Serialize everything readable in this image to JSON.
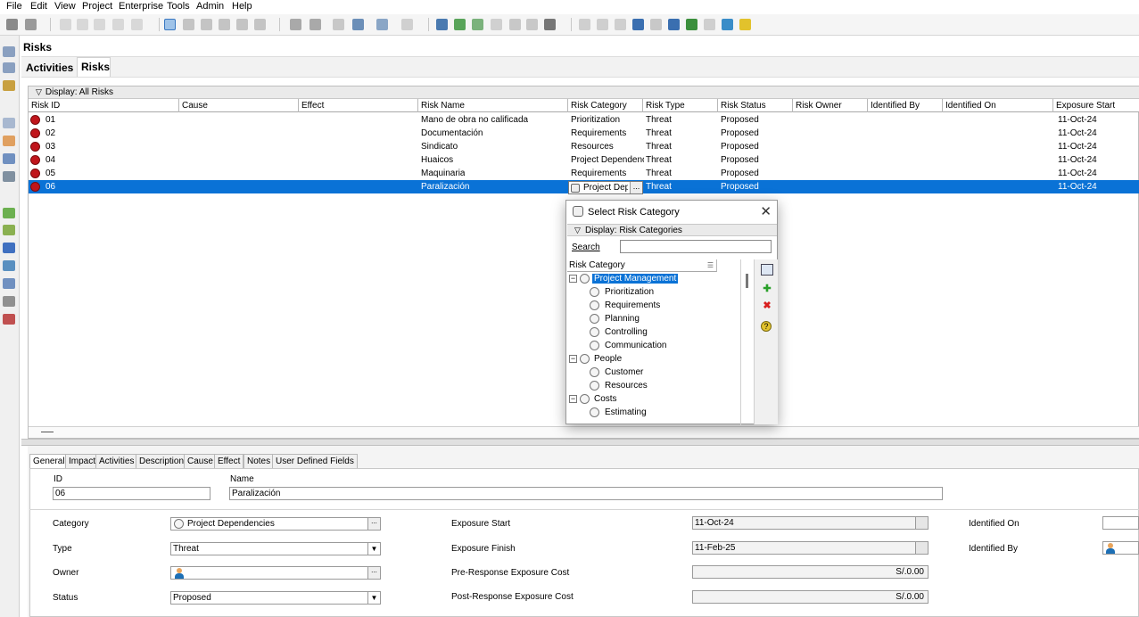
{
  "menu": [
    "File",
    "Edit",
    "View",
    "Project",
    "Enterprise",
    "Tools",
    "Admin",
    "Help"
  ],
  "page_title": "Risks",
  "tabs": {
    "activities": "Activities",
    "risks": "Risks"
  },
  "grid": {
    "display_label": "Display: All Risks",
    "columns": [
      "Risk ID",
      "Cause",
      "Effect",
      "Risk Name",
      "Risk Category",
      "Risk Type",
      "Risk Status",
      "Risk Owner",
      "Identified By",
      "Identified On",
      "Exposure Start"
    ],
    "rows": [
      {
        "id": "01",
        "name": "Mano de obra no calificada",
        "category": "Prioritization",
        "type": "Threat",
        "status": "Proposed",
        "start": "11-Oct-24"
      },
      {
        "id": "02",
        "name": "Documentación",
        "category": "Requirements",
        "type": "Threat",
        "status": "Proposed",
        "start": "11-Oct-24"
      },
      {
        "id": "03",
        "name": "Sindicato",
        "category": "Resources",
        "type": "Threat",
        "status": "Proposed",
        "start": "11-Oct-24"
      },
      {
        "id": "04",
        "name": "Huaicos",
        "category": "Project Dependenci",
        "type": "Threat",
        "status": "Proposed",
        "start": "11-Oct-24"
      },
      {
        "id": "05",
        "name": "Maquinaria",
        "category": "Requirements",
        "type": "Threat",
        "status": "Proposed",
        "start": "11-Oct-24"
      },
      {
        "id": "06",
        "name": "Paralización",
        "category": "Project Depe",
        "type": "Threat",
        "status": "Proposed",
        "start": "11-Oct-24",
        "selected": true
      }
    ],
    "editor_dots": "..."
  },
  "popup": {
    "title": "Select Risk Category",
    "display_label": "Display: Risk Categories",
    "search_label": "Search",
    "search_value": "",
    "column_header": "Risk Category",
    "tree": [
      {
        "label": "Project Management",
        "level": 0,
        "expanded": true,
        "selected": true
      },
      {
        "label": "Prioritization",
        "level": 1
      },
      {
        "label": "Requirements",
        "level": 1
      },
      {
        "label": "Planning",
        "level": 1
      },
      {
        "label": "Controlling",
        "level": 1
      },
      {
        "label": "Communication",
        "level": 1
      },
      {
        "label": "People",
        "level": 0,
        "expanded": true
      },
      {
        "label": "Customer",
        "level": 1
      },
      {
        "label": "Resources",
        "level": 1
      },
      {
        "label": "Costs",
        "level": 0,
        "expanded": true
      },
      {
        "label": "Estimating",
        "level": 1
      }
    ],
    "close_glyph": "✕",
    "expand_glyph": "−"
  },
  "detail_tabs": [
    "General",
    "Impact",
    "Activities",
    "Description",
    "Cause",
    "Effect",
    "Notes",
    "User Defined Fields"
  ],
  "details": {
    "id_label": "ID",
    "id_value": "06",
    "name_label": "Name",
    "name_value": "Paralización",
    "category_label": "Category",
    "category_value": "Project Dependencies",
    "type_label": "Type",
    "type_value": "Threat",
    "owner_label": "Owner",
    "owner_value": "",
    "status_label": "Status",
    "status_value": "Proposed",
    "exposure_start_label": "Exposure Start",
    "exposure_start_value": "11-Oct-24",
    "exposure_finish_label": "Exposure Finish",
    "exposure_finish_value": "11-Feb-25",
    "pre_cost_label": "Pre-Response Exposure Cost",
    "pre_cost_value": "S/.0.00",
    "post_cost_label": "Post-Response Exposure Cost",
    "post_cost_value": "S/.0.00",
    "identified_on_label": "Identified On",
    "identified_by_label": "Identified By",
    "ellipsis": "...",
    "dropdown_arrow": "▼"
  },
  "colors": {
    "selection": "#0a72d6",
    "risk_icon": "#c0151b",
    "delete": "#d81e1e",
    "add": "#2aa02a"
  }
}
